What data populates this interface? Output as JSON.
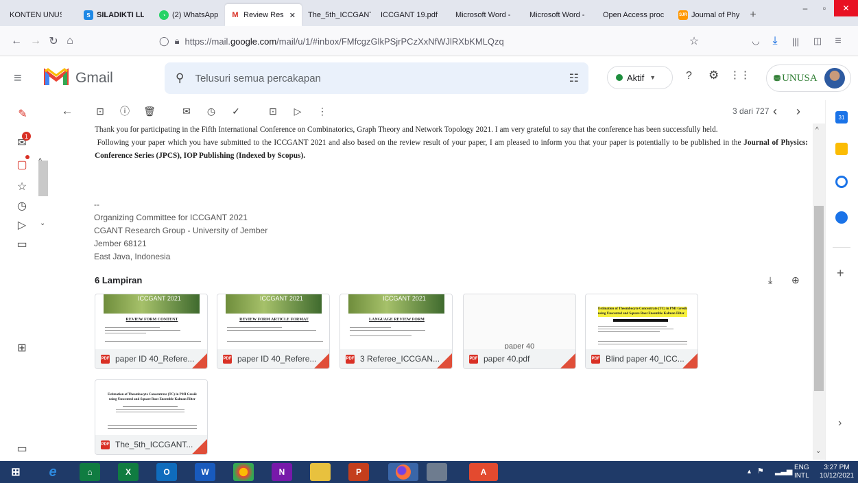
{
  "browser": {
    "tabs": [
      {
        "label": "KONTEN UNUSA"
      },
      {
        "label": "SILADIKTI LL"
      },
      {
        "label": "(2) WhatsApp"
      },
      {
        "label": "Review Res"
      },
      {
        "label": "The_5th_ICCGANT"
      },
      {
        "label": "ICCGANT 19.pdf"
      },
      {
        "label": "Microsoft Word -"
      },
      {
        "label": "Microsoft Word -"
      },
      {
        "label": "Open Access proc"
      },
      {
        "label": "Journal of Phy"
      }
    ],
    "url_prefix": "https://mail.",
    "url_domain": "google.com",
    "url_path": "/mail/u/1/#inbox/FMfcgzGlkPSjrPCzXxNfWJlRXbKMLQzq"
  },
  "gmail": {
    "brand": "Gmail",
    "search_placeholder": "Telusuri semua percakapan",
    "status": "Aktif",
    "org_label": "UNUSA",
    "pagination": "3 dari 727",
    "notification_count": "1"
  },
  "email": {
    "para1": "Thank you for participating in the Fifth International Conference on Combinatorics, Graph Theory and Network Topology 2021. I am very grateful to  say that the conference has been successfully held.",
    "para2a": "Following  your  paper  which  you  have submitted to the ICCGANT 2021 and also based on the review result of your paper, I am pleased to inform you that your paper is potentially to be published in the ",
    "para2b": "Journal of Physics: Conference Series (JPCS), IOP Publishing (Indexed by Scopus).",
    "sig_dash": "--",
    "sig1": "Organizing Committee for ICCGANT 2021",
    "sig2": "CGANT Research Group - University of Jember",
    "sig3": "Jember 68121",
    "sig4": "East Java, Indonesia"
  },
  "attachments": {
    "title": "6 Lampiran",
    "items": [
      {
        "name": "paper ID 40_Refere...",
        "thumb_title": "ICCGANT 2021",
        "thumb_heading": "REVIEW FORM CONTENT"
      },
      {
        "name": "paper ID 40_Refere...",
        "thumb_title": "ICCGANT 2021",
        "thumb_heading": "REVIEW FORM ARTICLE FORMAT"
      },
      {
        "name": "3 Referee_ICCGAN...",
        "thumb_title": "ICCGANT 2021",
        "thumb_heading": "LANGUAGE REVIEW FORM"
      },
      {
        "name": "paper 40.pdf",
        "thumb_text": "paper 40"
      },
      {
        "name": "Blind paper 40_ICC...",
        "thumb_title": "Estimation of Theombocyte Concentrate (TC) in PMI Gresik using Unscented and Square Root Ensemble Kalman Filter"
      },
      {
        "name": "The_5th_ICCGANT...",
        "thumb_title": "Estimation of Theombocyte Concentrate (TC) in PMI Gresik using Unscented and Square Root Ensemble Kalman Filter"
      }
    ]
  },
  "taskbar": {
    "lang1": "ENG",
    "lang2": "INTL",
    "time": "3:27 PM",
    "date": "10/12/2021"
  }
}
